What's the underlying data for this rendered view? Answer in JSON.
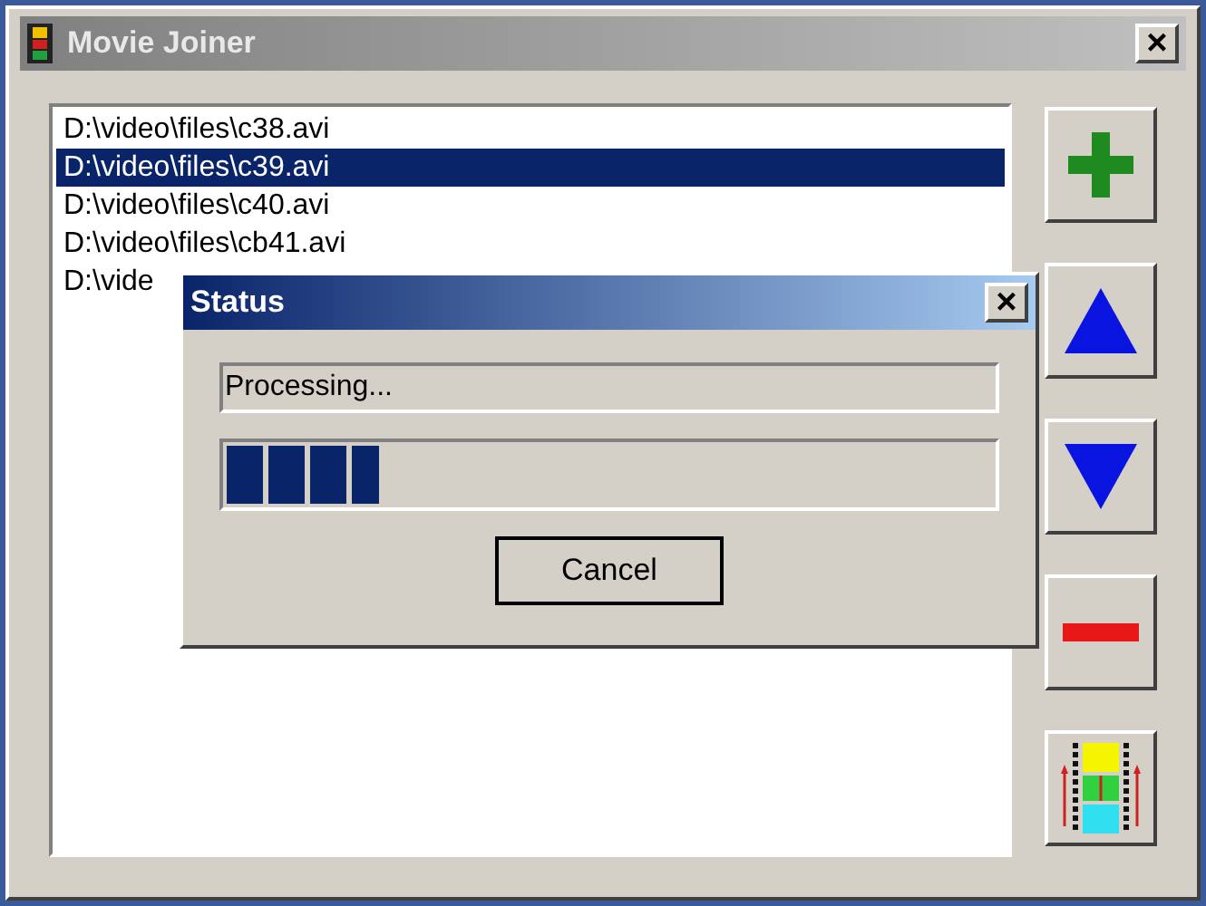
{
  "window": {
    "title": "Movie Joiner",
    "close": "×"
  },
  "file_list": [
    {
      "text": "D:\\video\\files\\c38.avi",
      "selected": false
    },
    {
      "text": "D:\\video\\files\\c39.avi",
      "selected": true
    },
    {
      "text": "D:\\video\\files\\c40.avi",
      "selected": false
    },
    {
      "text": "D:\\video\\files\\cb41.avi",
      "selected": false
    },
    {
      "text": "D:\\vide",
      "selected": false
    }
  ],
  "side_buttons": [
    {
      "kind": "add"
    },
    {
      "kind": "up"
    },
    {
      "kind": "down"
    },
    {
      "kind": "remove"
    },
    {
      "kind": "join"
    }
  ],
  "status_dialog": {
    "title": "Status",
    "close": "×",
    "message": "Processing...",
    "progress": {
      "level": 0.2
    },
    "button": "Cancel"
  }
}
